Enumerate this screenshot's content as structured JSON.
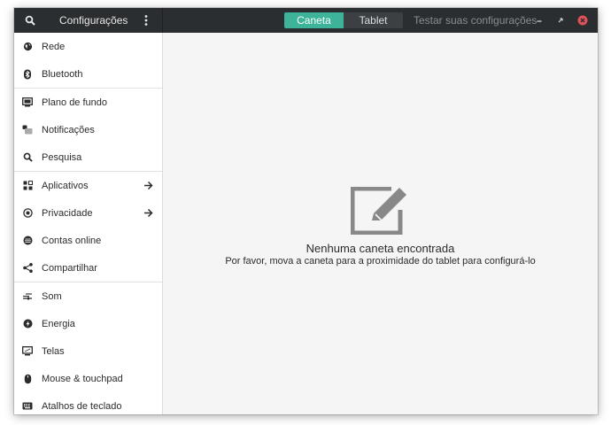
{
  "header": {
    "title": "Configurações",
    "tabs": [
      {
        "label": "Caneta",
        "active": true
      },
      {
        "label": "Tablet",
        "active": false
      }
    ],
    "test_button": "Testar suas configurações"
  },
  "sidebar": {
    "items": [
      {
        "label": "Rede",
        "icon": "globe-icon"
      },
      {
        "label": "Bluetooth",
        "icon": "bluetooth-icon"
      },
      {
        "label": "Plano de fundo",
        "icon": "background-icon"
      },
      {
        "label": "Notificações",
        "icon": "notifications-icon"
      },
      {
        "label": "Pesquisa",
        "icon": "search-icon"
      },
      {
        "label": "Aplicativos",
        "icon": "apps-grid-icon",
        "has_arrow": true
      },
      {
        "label": "Privacidade",
        "icon": "privacy-icon",
        "has_arrow": true
      },
      {
        "label": "Contas online",
        "icon": "online-accounts-icon"
      },
      {
        "label": "Compartilhar",
        "icon": "share-icon"
      },
      {
        "label": "Som",
        "icon": "sound-icon"
      },
      {
        "label": "Energia",
        "icon": "power-icon"
      },
      {
        "label": "Telas",
        "icon": "displays-icon"
      },
      {
        "label": "Mouse & touchpad",
        "icon": "mouse-icon"
      },
      {
        "label": "Atalhos de teclado",
        "icon": "keyboard-icon"
      }
    ]
  },
  "main": {
    "empty_title": "Nenhuma caneta encontrada",
    "empty_subtitle": "Por favor, mova a caneta para a proximidade do tablet para configurá-lo"
  },
  "colors": {
    "accent": "#3db39a",
    "headerbar": "#2b2e30",
    "close": "#e0505a"
  }
}
